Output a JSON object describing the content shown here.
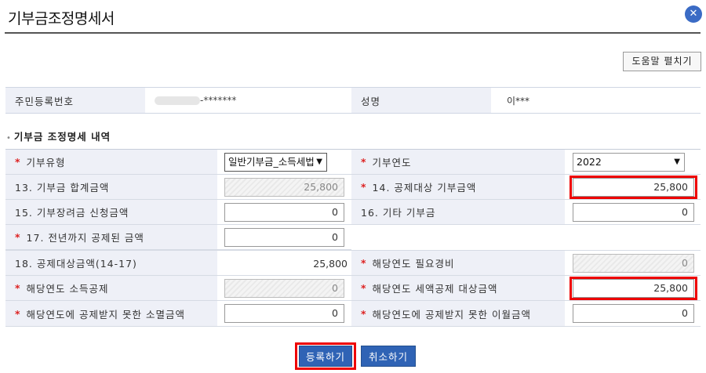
{
  "dialog": {
    "title": "기부금조정명세서",
    "close_glyph": "✕",
    "help_button": "도움말 펼치기"
  },
  "info": {
    "id_label": "주민등록번호",
    "id_value": "-*******",
    "name_label": "성명",
    "name_value": "이***"
  },
  "section": {
    "bullet": "•",
    "title": "기부금 조정명세 내역"
  },
  "form": {
    "required_mark": "*",
    "type_label": "기부유형",
    "type_value": "일반기부금_소득세법",
    "year_label": "기부연도",
    "year_value": "2022",
    "item13_label": "13. 기부금 합계금액",
    "item13_value": "25,800",
    "item14_label": "14. 공제대상 기부금액",
    "item14_value": "25,800",
    "item15_label": "15. 기부장려금 신청금액",
    "item15_value": "0",
    "item16_label": "16. 기타 기부금",
    "item16_value": "0",
    "item17_label": "17. 전년까지 공제된 금액",
    "item17_value": "0",
    "item18_label": "18. 공제대상금액(14-17)",
    "item18_value": "25,800",
    "expense_label": "해당연도 필요경비",
    "expense_value": "0",
    "income_deduct_label": "해당연도 소득공제",
    "income_deduct_value": "0",
    "tax_credit_label": "해당연도 세액공제 대상금액",
    "tax_credit_value": "25,800",
    "expired_label": "해당연도에 공제받지 못한 소멸금액",
    "expired_value": "0",
    "carryover_label": "해당연도에 공제받지 못한 이월금액",
    "carryover_value": "0"
  },
  "buttons": {
    "register": "등록하기",
    "cancel": "취소하기"
  },
  "colors": {
    "label_bg": "#eef0f7",
    "primary": "#2f63b5",
    "highlight": "#e00000",
    "required": "#d22222"
  }
}
